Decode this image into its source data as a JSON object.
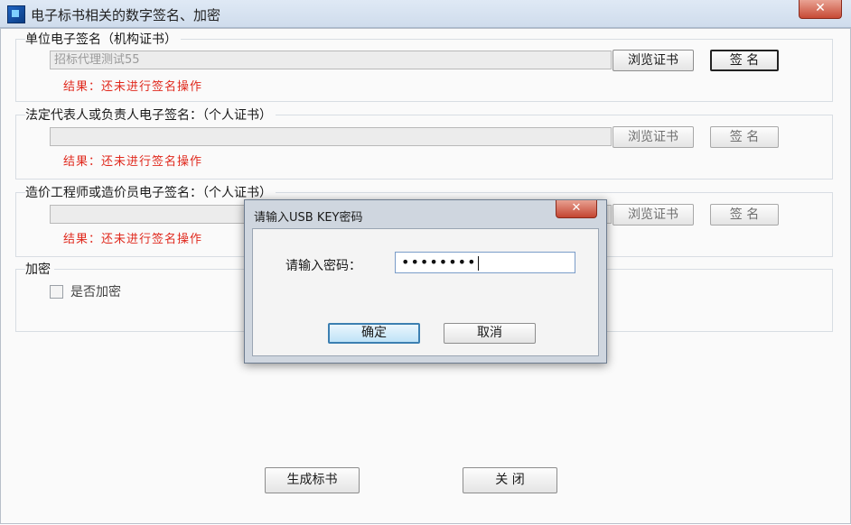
{
  "window": {
    "title": "电子标书相关的数字签名、加密",
    "close_label": "✕"
  },
  "sections": {
    "org": {
      "label": "单位电子签名（机构证书）",
      "cert_value": "招标代理测试55",
      "browse_label": "浏览证书",
      "sign_label": "签  名",
      "result": "结果：还未进行签名操作"
    },
    "legal": {
      "label": "法定代表人或负责人电子签名：（个人证书）",
      "cert_value": "",
      "browse_label": "浏览证书",
      "sign_label": "签  名",
      "result": "结果：还未进行签名操作"
    },
    "cost": {
      "label": "造价工程师或造价员电子签名：（个人证书）",
      "cert_value": "",
      "browse_label": "浏览证书",
      "sign_label": "签  名",
      "result": "结果：还未进行签名操作"
    },
    "encrypt": {
      "label": "加密",
      "checkbox_label": "是否加密",
      "checked": false
    }
  },
  "footer": {
    "generate_label": "生成标书",
    "close_label": "关  闭"
  },
  "dialog": {
    "title": "请输入USB KEY密码",
    "close_label": "✕",
    "prompt": "请输入密码：",
    "password_mask": "••••••••",
    "ok_label": "确定",
    "cancel_label": "取消"
  }
}
